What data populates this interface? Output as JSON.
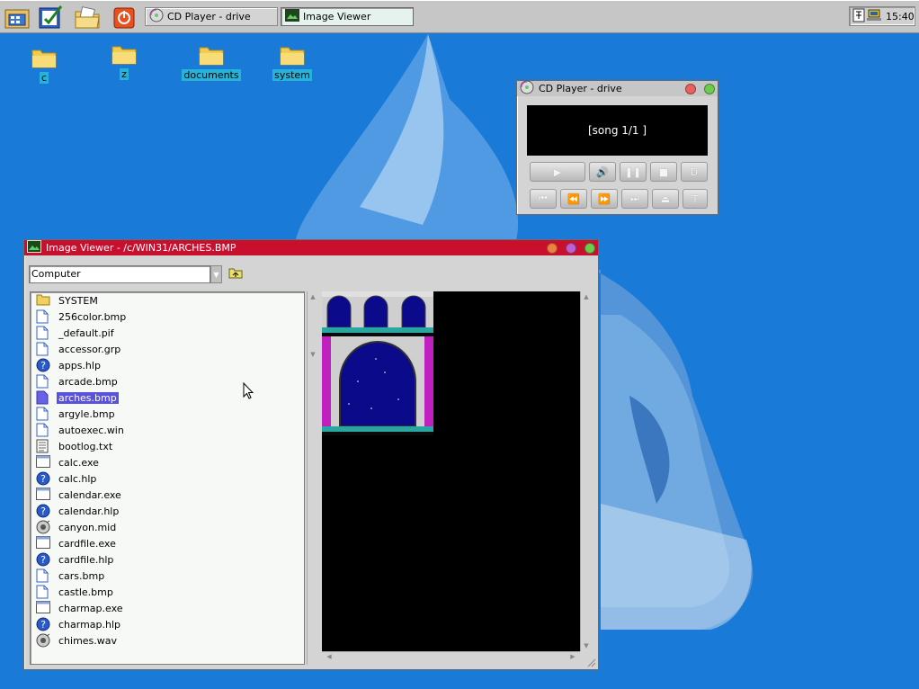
{
  "taskbar": {
    "launchers": [
      "file-manager-icon",
      "control-panel-icon",
      "documents-folder-icon",
      "shutdown-icon"
    ],
    "tasks": [
      {
        "label": "CD Player - drive",
        "icon": "cd-icon",
        "active": false
      },
      {
        "label": "Image Viewer",
        "icon": "image-viewer-icon",
        "active": true
      }
    ],
    "tray": {
      "icons": [
        "keyboard-icon",
        "network-icon"
      ],
      "clock": "15:40"
    }
  },
  "desktop": {
    "icons": [
      {
        "label": "c"
      },
      {
        "label": "z"
      },
      {
        "label": "documents"
      },
      {
        "label": "system"
      }
    ]
  },
  "cd_player": {
    "title": "CD Player - drive",
    "display": "[song 1/1 ]",
    "buttons_row1": [
      "play",
      "volume",
      "pause",
      "stop",
      "D"
    ],
    "buttons_row2": [
      "previous-track",
      "rewind",
      "fast-forward",
      "next-track",
      "eject",
      "T"
    ]
  },
  "image_viewer": {
    "title": "Image Viewer - /c/WIN31/ARCHES.BMP",
    "location": "Computer",
    "files": [
      {
        "name": "SYSTEM",
        "type": "folder"
      },
      {
        "name": "256color.bmp",
        "type": "file"
      },
      {
        "name": "_default.pif",
        "type": "file"
      },
      {
        "name": "accessor.grp",
        "type": "file"
      },
      {
        "name": "apps.hlp",
        "type": "help"
      },
      {
        "name": "arcade.bmp",
        "type": "file"
      },
      {
        "name": "arches.bmp",
        "type": "file",
        "selected": true
      },
      {
        "name": "argyle.bmp",
        "type": "file"
      },
      {
        "name": "autoexec.win",
        "type": "file"
      },
      {
        "name": "bootlog.txt",
        "type": "text"
      },
      {
        "name": "calc.exe",
        "type": "exe"
      },
      {
        "name": "calc.hlp",
        "type": "help"
      },
      {
        "name": "calendar.exe",
        "type": "exe"
      },
      {
        "name": "calendar.hlp",
        "type": "help"
      },
      {
        "name": "canyon.mid",
        "type": "audio"
      },
      {
        "name": "cardfile.exe",
        "type": "exe"
      },
      {
        "name": "cardfile.hlp",
        "type": "help"
      },
      {
        "name": "cars.bmp",
        "type": "file"
      },
      {
        "name": "castle.bmp",
        "type": "file"
      },
      {
        "name": "charmap.exe",
        "type": "exe"
      },
      {
        "name": "charmap.hlp",
        "type": "help"
      },
      {
        "name": "chimes.wav",
        "type": "audio"
      }
    ]
  },
  "colors": {
    "desktop": "#1a7ad8",
    "viewer_titlebar": "#c8102e",
    "cd_titlebar": "#c6c6c6",
    "selection": "#5a52dc",
    "folder_label_bg": "#27b3d9"
  }
}
